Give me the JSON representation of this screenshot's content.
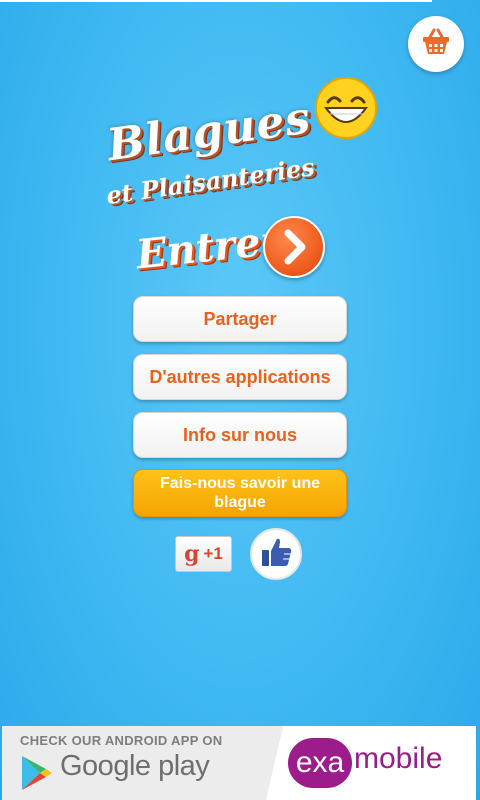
{
  "app": {
    "logo_title": "Blagues",
    "logo_subtitle": "et Plaisanteries",
    "enter_label": "Entrer"
  },
  "menu": {
    "share": "Partager",
    "other_apps": "D'autres applications",
    "about": "Info sur nous",
    "submit_joke": "Fais-nous savoir une blague"
  },
  "social": {
    "gplus_g": "g",
    "gplus_label": "+1"
  },
  "icons": {
    "cart": "shopping-basket-icon",
    "smiley": "laughing-smiley-icon",
    "enter": "chevron-right-icon",
    "like": "thumbs-up-icon",
    "google_play": "google-play-icon"
  },
  "ad": {
    "caption": "CHECK OUR ANDROID APP ON",
    "store": "Google play",
    "brand_badge": "exa",
    "brand_rest": "mobile"
  },
  "colors": {
    "background": "#3fb8f2",
    "accent_orange": "#e8621d",
    "submit_yellow": "#f7a300",
    "brand_purple": "#9c1c8c"
  }
}
